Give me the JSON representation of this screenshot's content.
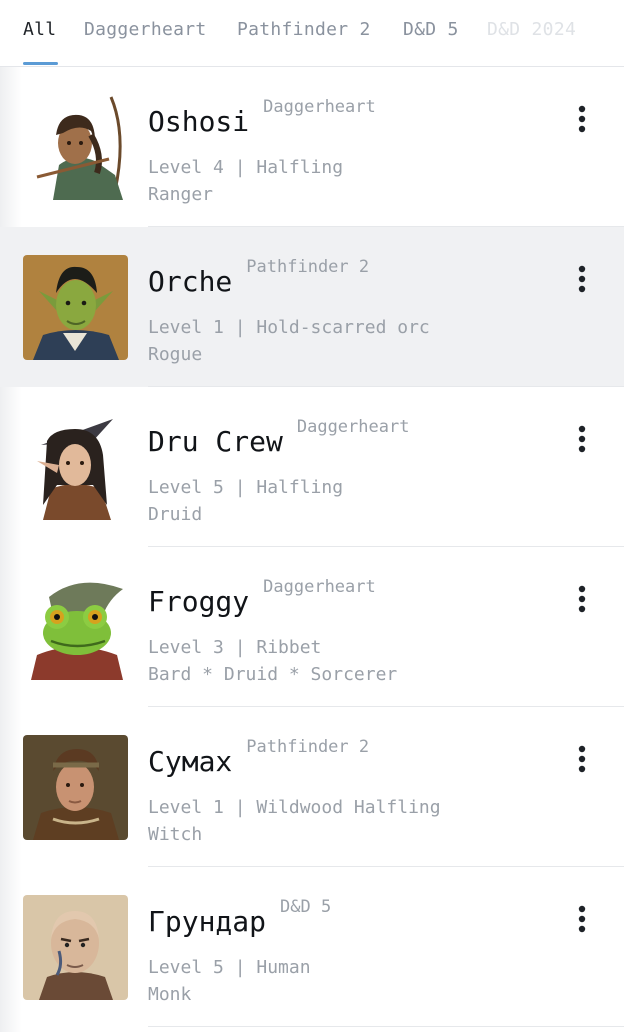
{
  "tabs": [
    {
      "label": "All"
    },
    {
      "label": "Daggerheart"
    },
    {
      "label": "Pathfinder 2"
    },
    {
      "label": "D&D 5"
    },
    {
      "label": "D&D 2024"
    }
  ],
  "characters": [
    {
      "name": "Oshosi",
      "system": "Daggerheart",
      "level_line": "Level 4 | Halfling",
      "class_line": "Ranger",
      "avatar_icon": "ranger-portrait-icon"
    },
    {
      "name": "Orche",
      "system": "Pathfinder 2",
      "level_line": "Level 1 | Hold-scarred orc",
      "class_line": "Rogue",
      "avatar_icon": "orc-portrait-icon"
    },
    {
      "name": "Dru Crew",
      "system": "Daggerheart",
      "level_line": "Level 5 | Halfling",
      "class_line": "Druid",
      "avatar_icon": "druid-portrait-icon"
    },
    {
      "name": "Froggy",
      "system": "Daggerheart",
      "level_line": "Level 3 | Ribbet",
      "class_line": "Bard * Druid * Sorcerer",
      "avatar_icon": "frog-portrait-icon"
    },
    {
      "name": "Сумах",
      "system": "Pathfinder 2",
      "level_line": "Level 1 | Wildwood Halfling",
      "class_line": "Witch",
      "avatar_icon": "witch-portrait-icon"
    },
    {
      "name": "Грундар",
      "system": "D&D 5",
      "level_line": "Level 5 | Human",
      "class_line": "Monk",
      "avatar_icon": "monk-portrait-icon"
    }
  ],
  "colors": {
    "accent": "#5b9bd5",
    "highlight_row": "#f0f1f3",
    "text_primary": "#111418",
    "text_secondary": "#9aa0a8"
  }
}
